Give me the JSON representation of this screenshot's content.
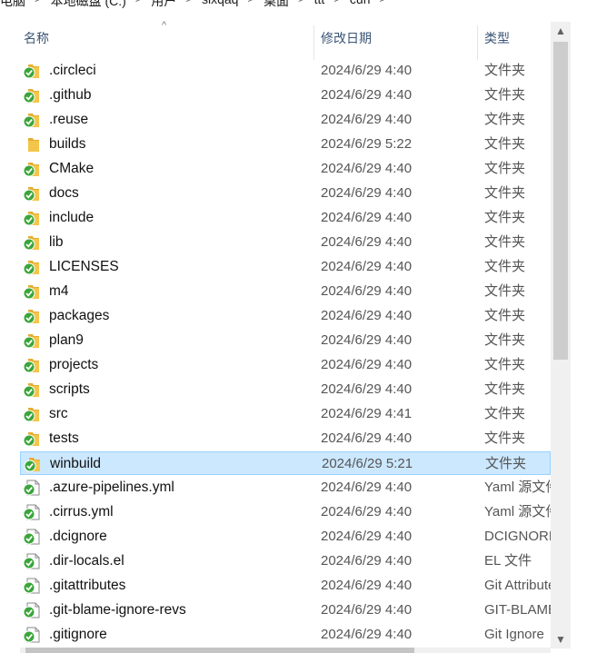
{
  "breadcrumb": [
    "电脑",
    "本地磁盘 (C:)",
    "用户",
    "sixqaq",
    "桌面",
    "ttt",
    "curl"
  ],
  "columns": {
    "name": "名称",
    "date": "修改日期",
    "type": "类型"
  },
  "rows": [
    {
      "name": ".circleci",
      "date": "2024/6/29 4:40",
      "type": "文件夹",
      "kind": "folder-synced"
    },
    {
      "name": ".github",
      "date": "2024/6/29 4:40",
      "type": "文件夹",
      "kind": "folder-synced"
    },
    {
      "name": ".reuse",
      "date": "2024/6/29 4:40",
      "type": "文件夹",
      "kind": "folder-synced"
    },
    {
      "name": "builds",
      "date": "2024/6/29 5:22",
      "type": "文件夹",
      "kind": "folder"
    },
    {
      "name": "CMake",
      "date": "2024/6/29 4:40",
      "type": "文件夹",
      "kind": "folder-synced"
    },
    {
      "name": "docs",
      "date": "2024/6/29 4:40",
      "type": "文件夹",
      "kind": "folder-synced"
    },
    {
      "name": "include",
      "date": "2024/6/29 4:40",
      "type": "文件夹",
      "kind": "folder-synced"
    },
    {
      "name": "lib",
      "date": "2024/6/29 4:40",
      "type": "文件夹",
      "kind": "folder-synced"
    },
    {
      "name": "LICENSES",
      "date": "2024/6/29 4:40",
      "type": "文件夹",
      "kind": "folder-synced"
    },
    {
      "name": "m4",
      "date": "2024/6/29 4:40",
      "type": "文件夹",
      "kind": "folder-synced"
    },
    {
      "name": "packages",
      "date": "2024/6/29 4:40",
      "type": "文件夹",
      "kind": "folder-synced"
    },
    {
      "name": "plan9",
      "date": "2024/6/29 4:40",
      "type": "文件夹",
      "kind": "folder-synced"
    },
    {
      "name": "projects",
      "date": "2024/6/29 4:40",
      "type": "文件夹",
      "kind": "folder-synced"
    },
    {
      "name": "scripts",
      "date": "2024/6/29 4:40",
      "type": "文件夹",
      "kind": "folder-synced"
    },
    {
      "name": "src",
      "date": "2024/6/29 4:41",
      "type": "文件夹",
      "kind": "folder-synced"
    },
    {
      "name": "tests",
      "date": "2024/6/29 4:40",
      "type": "文件夹",
      "kind": "folder-synced"
    },
    {
      "name": "winbuild",
      "date": "2024/6/29 5:21",
      "type": "文件夹",
      "kind": "folder-synced",
      "selected": true
    },
    {
      "name": ".azure-pipelines.yml",
      "date": "2024/6/29 4:40",
      "type": "Yaml 源文件",
      "kind": "file-synced"
    },
    {
      "name": ".cirrus.yml",
      "date": "2024/6/29 4:40",
      "type": "Yaml 源文件",
      "kind": "file-synced"
    },
    {
      "name": ".dcignore",
      "date": "2024/6/29 4:40",
      "type": "DCIGNORE 文件",
      "kind": "file-synced"
    },
    {
      "name": ".dir-locals.el",
      "date": "2024/6/29 4:40",
      "type": "EL 文件",
      "kind": "file-synced"
    },
    {
      "name": ".gitattributes",
      "date": "2024/6/29 4:40",
      "type": "Git Attributes",
      "kind": "file-synced"
    },
    {
      "name": ".git-blame-ignore-revs",
      "date": "2024/6/29 4:40",
      "type": "GIT-BLAME",
      "kind": "file-synced"
    },
    {
      "name": ".gitignore",
      "date": "2024/6/29 4:40",
      "type": "Git Ignore",
      "kind": "file-synced"
    }
  ],
  "colors": {
    "selection_bg": "#cce8ff",
    "selection_border": "#99d1ff",
    "sync_green": "#3aa63a",
    "folder_yellow": "#f3c54b"
  },
  "scrollbar": {
    "vertical_thumb_fraction": 0.5
  }
}
